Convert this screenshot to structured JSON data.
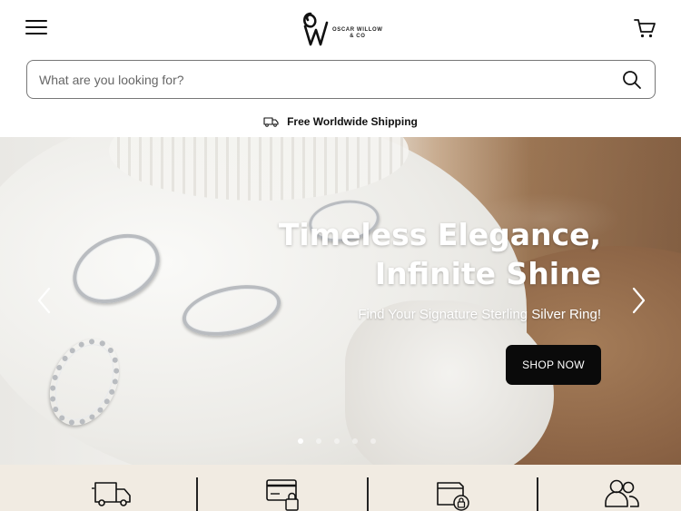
{
  "header": {
    "logo_text_line1": "OSCAR WILLOW",
    "logo_text_line2": "& CO",
    "menu_icon": "hamburger-menu-icon",
    "cart_icon": "shopping-cart-icon"
  },
  "search": {
    "placeholder": "What are you looking for?",
    "value": "",
    "icon": "search-icon"
  },
  "announcement": {
    "icon": "delivery-truck-icon",
    "text": "Free Worldwide Shipping"
  },
  "hero": {
    "title_line1": "Timeless Elegance,",
    "title_line2": "Infinite Shine",
    "subtitle": "Find Your Signature Sterling Silver Ring!",
    "cta_label": "SHOP NOW",
    "prev_icon": "chevron-left-icon",
    "next_icon": "chevron-right-icon",
    "slide_count": 5,
    "active_slide": 1
  },
  "features": [
    {
      "icon": "delivery-truck-icon"
    },
    {
      "icon": "secure-card-icon"
    },
    {
      "icon": "secure-wallet-icon"
    },
    {
      "icon": "customers-icon"
    }
  ],
  "colors": {
    "button_bg": "#0a0a0a",
    "feature_bar_bg": "#f1ebe2",
    "text_dark": "#111111"
  }
}
